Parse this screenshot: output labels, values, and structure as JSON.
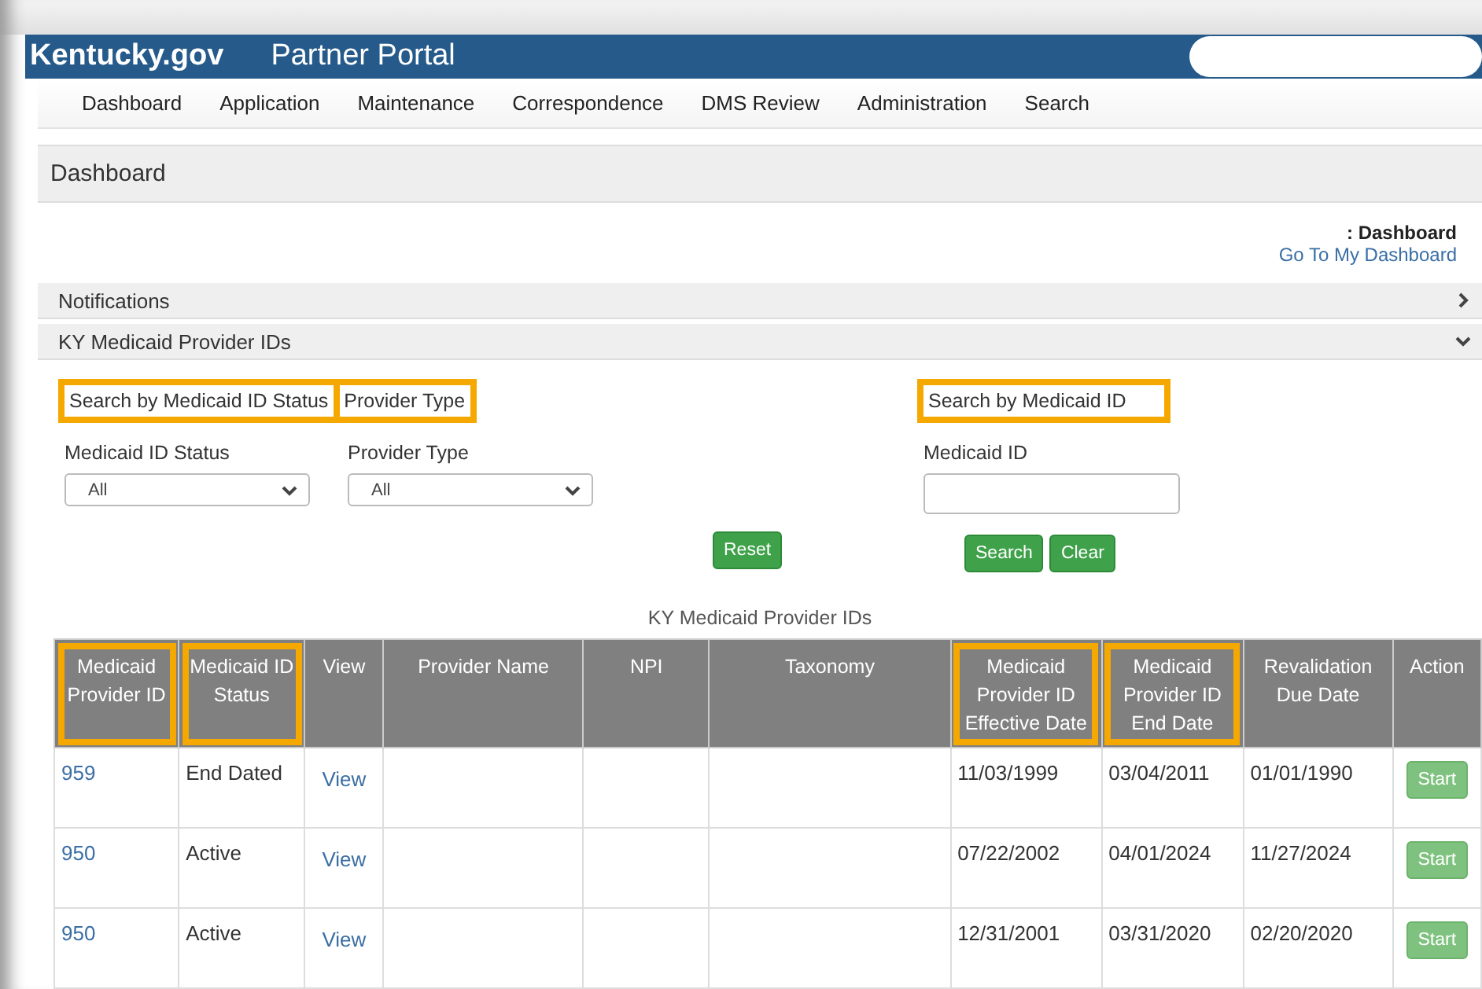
{
  "header": {
    "logo": "Kentucky.gov",
    "title": "Partner Portal"
  },
  "nav": [
    "Dashboard",
    "Application",
    "Maintenance",
    "Correspondence",
    "DMS Review",
    "Administration",
    "Search"
  ],
  "page_title": "Dashboard",
  "breadcrumb": ": Dashboard",
  "dashboard_link": "Go To My Dashboard",
  "panels": [
    {
      "title": "Notifications",
      "expanded": false
    },
    {
      "title": "KY Medicaid Provider IDs",
      "expanded": true
    }
  ],
  "search_groups": [
    {
      "label": "Search by Medicaid ID Status",
      "highlighted": true
    },
    {
      "label": "Provider Type",
      "highlighted": true
    },
    {
      "label": "Search by Medicaid ID",
      "highlighted": true
    }
  ],
  "filters": [
    {
      "label": "Medicaid ID Status",
      "value": "All"
    },
    {
      "label": "Provider Type",
      "value": "All"
    }
  ],
  "id_field": {
    "label": "Medicaid ID"
  },
  "buttons": {
    "reset": "Reset",
    "search": "Search",
    "clear": "Clear"
  },
  "table": {
    "caption": "KY Medicaid Provider IDs",
    "columns": [
      {
        "label": "Medicaid Provider ID",
        "highlighted": true
      },
      {
        "label": "Medicaid ID Status",
        "highlighted": true
      },
      {
        "label": "View",
        "highlighted": false
      },
      {
        "label": "Provider Name",
        "highlighted": false
      },
      {
        "label": "NPI",
        "highlighted": false
      },
      {
        "label": "Taxonomy",
        "highlighted": false
      },
      {
        "label": "Medicaid Provider ID Effective Date",
        "highlighted": true
      },
      {
        "label": "Medicaid Provider ID End Date",
        "highlighted": true
      },
      {
        "label": "Revalidation Due Date",
        "highlighted": false
      },
      {
        "label": "Action",
        "highlighted": false
      }
    ],
    "rows": [
      {
        "id": "959",
        "status": "End Dated",
        "view": "View",
        "effective": "11/03/1999",
        "end": "03/04/2011",
        "revalidation": "01/01/1990",
        "action": "Start"
      },
      {
        "id": "950",
        "status": "Active",
        "view": "View",
        "effective": "07/22/2002",
        "end": "04/01/2024",
        "revalidation": "11/27/2024",
        "action": "Start"
      },
      {
        "id": "950",
        "status": "Active",
        "view": "View",
        "effective": "12/31/2001",
        "end": "03/31/2020",
        "revalidation": "02/20/2020",
        "action": "Start"
      }
    ]
  }
}
